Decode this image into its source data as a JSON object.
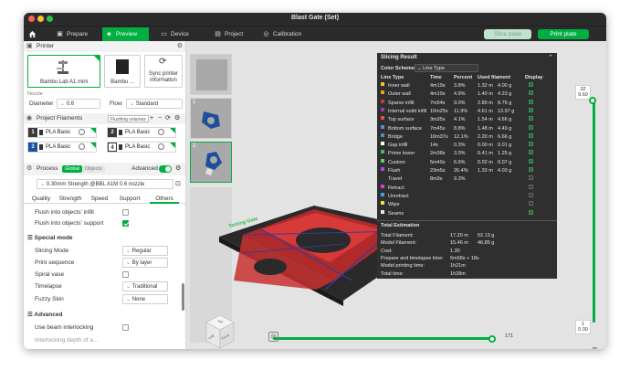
{
  "window": {
    "title": "Blast Gate (Set)"
  },
  "toolbar": {
    "tabs": [
      {
        "label": "Prepare",
        "icon": "cube-icon"
      },
      {
        "label": "Preview",
        "icon": "preview-icon"
      },
      {
        "label": "Device",
        "icon": "monitor-icon"
      },
      {
        "label": "Project",
        "icon": "folder-icon"
      },
      {
        "label": "Calibration",
        "icon": "calibration-icon"
      }
    ],
    "active_tab": "Preview",
    "slice_plate": "Slice plate",
    "print_plate": "Print plate"
  },
  "printer": {
    "section_title": "Printer",
    "printer_name": "Bambu Lab A1 mini",
    "plate_name": "Bambu ...",
    "sync_label_1": "Sync printer",
    "sync_label_2": "information",
    "nozzle_label": "Nozzle",
    "diameter_label": "Diameter",
    "diameter_value": "0.6",
    "flow_label": "Flow",
    "flow_value": "Standard"
  },
  "filaments": {
    "section_title": "Project Filaments",
    "flushing_volumes": "Flushing volumes",
    "items": [
      {
        "num": "1",
        "name": "PLA Basic",
        "color": "#3a3a3a"
      },
      {
        "num": "2",
        "name": "PLA Basic",
        "color": "#3a3a3a"
      },
      {
        "num": "3",
        "name": "PLA Basic",
        "color": "#1a4fa3"
      },
      {
        "num": "4",
        "name": "PLA Basic",
        "color": "#3a3a3a"
      }
    ]
  },
  "process": {
    "section_title": "Process",
    "toggle_global": "Global",
    "toggle_objects": "Objects",
    "advanced_label": "Advanced",
    "preset": "0.30mm Strength @BBL A1M 0.6 nozzle",
    "tabs": [
      "Quality",
      "Strength",
      "Speed",
      "Support",
      "Others"
    ],
    "active_tab": "Others",
    "flush_infill": "Flush into objects' infill",
    "flush_support": "Flush into objects' support",
    "special_mode_title": "Special mode",
    "slicing_mode_label": "Slicing Mode",
    "slicing_mode_value": "Regular",
    "print_sequence_label": "Print sequence",
    "print_sequence_value": "By layer",
    "spiral_vase_label": "Spiral vase",
    "timelapse_label": "Timelapse",
    "timelapse_value": "Traditional",
    "fuzzy_skin_label": "Fuzzy Skin",
    "fuzzy_skin_value": "None",
    "advanced_title": "Advanced",
    "beam_label": "Use beam interlocking",
    "cut_label": "Interlocking depth of a..."
  },
  "plates": [
    {
      "num": "1"
    },
    {
      "num": "2"
    }
  ],
  "model_label": "Testing Gate",
  "slicing_result": {
    "title": "Slicing Result",
    "color_scheme_label": "Color Scheme",
    "color_scheme_value": "Line Type",
    "headers": [
      "Line Type",
      "Time",
      "Percent",
      "Used filament",
      "Display"
    ],
    "rows": [
      {
        "name": "Inner wall",
        "color": "#f0c430",
        "time": "4m19s",
        "percent": "3.8%",
        "len": "1.32 m",
        "weight": "4.00 g",
        "display": true
      },
      {
        "name": "Outer wall",
        "color": "#f5a024",
        "time": "4m19s",
        "percent": "4.9%",
        "len": "1.40 m",
        "weight": "4.23 g",
        "display": true
      },
      {
        "name": "Sparse infill",
        "color": "#c43a3a",
        "time": "7m54s",
        "percent": "9.0%",
        "len": "2.89 m",
        "weight": "8.76 g",
        "display": true
      },
      {
        "name": "Internal solid infill",
        "color": "#9b3aa8",
        "time": "10m25s",
        "percent": "11.9%",
        "len": "4.61 m",
        "weight": "13.97 g",
        "display": true
      },
      {
        "name": "Top surface",
        "color": "#e05050",
        "time": "3m35s",
        "percent": "4.1%",
        "len": "1.54 m",
        "weight": "4.66 g",
        "display": true
      },
      {
        "name": "Bottom surface",
        "color": "#5a8ad8",
        "time": "7m45s",
        "percent": "8.8%",
        "len": "1.48 m",
        "weight": "4.49 g",
        "display": true
      },
      {
        "name": "Bridge",
        "color": "#4a90c0",
        "time": "10m37s",
        "percent": "12.1%",
        "len": "2.20 m",
        "weight": "6.66 g",
        "display": true
      },
      {
        "name": "Gap infill",
        "color": "#ffffff",
        "time": "14s",
        "percent": "0.3%",
        "len": "0.00 m",
        "weight": "0.01 g",
        "display": true
      },
      {
        "name": "Prime tower",
        "color": "#3ac060",
        "time": "2m38s",
        "percent": "3.0%",
        "len": "0.41 m",
        "weight": "1.25 g",
        "display": true
      },
      {
        "name": "Custom",
        "color": "#58d070",
        "time": "5m49s",
        "percent": "6.6%",
        "len": "0.02 m",
        "weight": "0.07 g",
        "display": true
      },
      {
        "name": "Flush",
        "color": "#a050e0",
        "time": "23m5s",
        "percent": "26.4%",
        "len": "1.33 m",
        "weight": "4.03 g",
        "display": true
      },
      {
        "name": "Travel",
        "color": "",
        "time": "8m9s",
        "percent": "9.3%",
        "len": "",
        "weight": "",
        "display": false
      },
      {
        "name": "Retract",
        "color": "#d040d0",
        "time": "",
        "percent": "",
        "len": "",
        "weight": "",
        "display": false
      },
      {
        "name": "Unretract",
        "color": "#40a0e0",
        "time": "",
        "percent": "",
        "len": "",
        "weight": "",
        "display": false
      },
      {
        "name": "Wipe",
        "color": "#f0e040",
        "time": "",
        "percent": "",
        "len": "",
        "weight": "",
        "display": false
      },
      {
        "name": "Seams",
        "color": "#e8e8e8",
        "time": "",
        "percent": "",
        "len": "",
        "weight": "",
        "display": true
      }
    ],
    "total_title": "Total Estimation",
    "totals": [
      {
        "label": "Total Filament:",
        "a": "17.20 m",
        "b": "52.13 g"
      },
      {
        "label": "Model Filament:",
        "a": "15.46 m",
        "b": "46.85 g"
      },
      {
        "label": "Cost:",
        "a": "1.30",
        "b": ""
      },
      {
        "label": "Prepare and timelapse time:",
        "a": "5m58s + 18s",
        "b": ""
      },
      {
        "label": "Model printing time:",
        "a": "1h21m",
        "b": ""
      },
      {
        "label": "Total time:",
        "a": "1h28m",
        "b": ""
      }
    ]
  },
  "layer_slider": {
    "top_layer": "32",
    "top_height": "9.60",
    "bottom_layer": "1",
    "bottom_height": "0.30",
    "top_fraction": 1.0
  },
  "move_slider": {
    "value": "171",
    "fraction": 1.0
  },
  "view_cube": {
    "top": "Top",
    "left": "Left",
    "front": "Front"
  },
  "colors": {
    "accent": "#00ae42",
    "dark": "#2b2b2b"
  }
}
